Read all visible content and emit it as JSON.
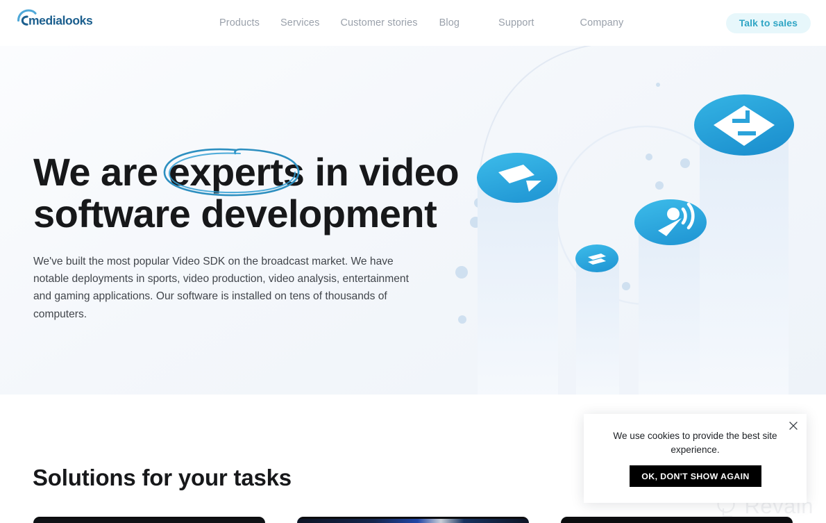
{
  "header": {
    "logo_text": "medialooks",
    "logo_icon": "medialooks-arc-logo",
    "nav": [
      {
        "label": "Products"
      },
      {
        "label": "Services"
      },
      {
        "label": "Customer stories"
      },
      {
        "label": "Blog"
      },
      {
        "label": "Support"
      },
      {
        "label": "Company"
      }
    ],
    "cta_label": "Talk to sales"
  },
  "hero": {
    "headline_part1": "We are",
    "headline_highlight": "experts",
    "headline_part2": "in video",
    "headline_line2": "software development",
    "paragraph": "We've built the most popular Video SDK on the broadcast market. We have notable deployments in sports, video production, video analysis, entertainment and gaming applications. Our software is installed on tens of thousands of computers.",
    "illustration": {
      "name": "video-pillars-illustration",
      "discs": [
        {
          "icon": "video-camera-icon"
        },
        {
          "icon": "layers-stack-icon"
        },
        {
          "icon": "broadcast-antenna-icon"
        },
        {
          "icon": "diamond-node-icon"
        }
      ]
    }
  },
  "solutions": {
    "title": "Solutions for your tasks",
    "cards": [
      {
        "name": "solution-card-1"
      },
      {
        "name": "solution-card-2"
      },
      {
        "name": "solution-card-3"
      }
    ]
  },
  "cookie": {
    "message": "We use cookies to provide the best site experience.",
    "accept_label": "OK, DON'T SHOW AGAIN",
    "close_icon": "close-icon"
  },
  "watermark": {
    "text": "Revain"
  },
  "colors": {
    "accent": "#29a8d8",
    "cta_bg": "#e7f7fb",
    "cta_text": "#2fa5c4",
    "nav_text": "#9aa1ab",
    "heading": "#17181a",
    "cookie_btn_bg": "#000000"
  }
}
